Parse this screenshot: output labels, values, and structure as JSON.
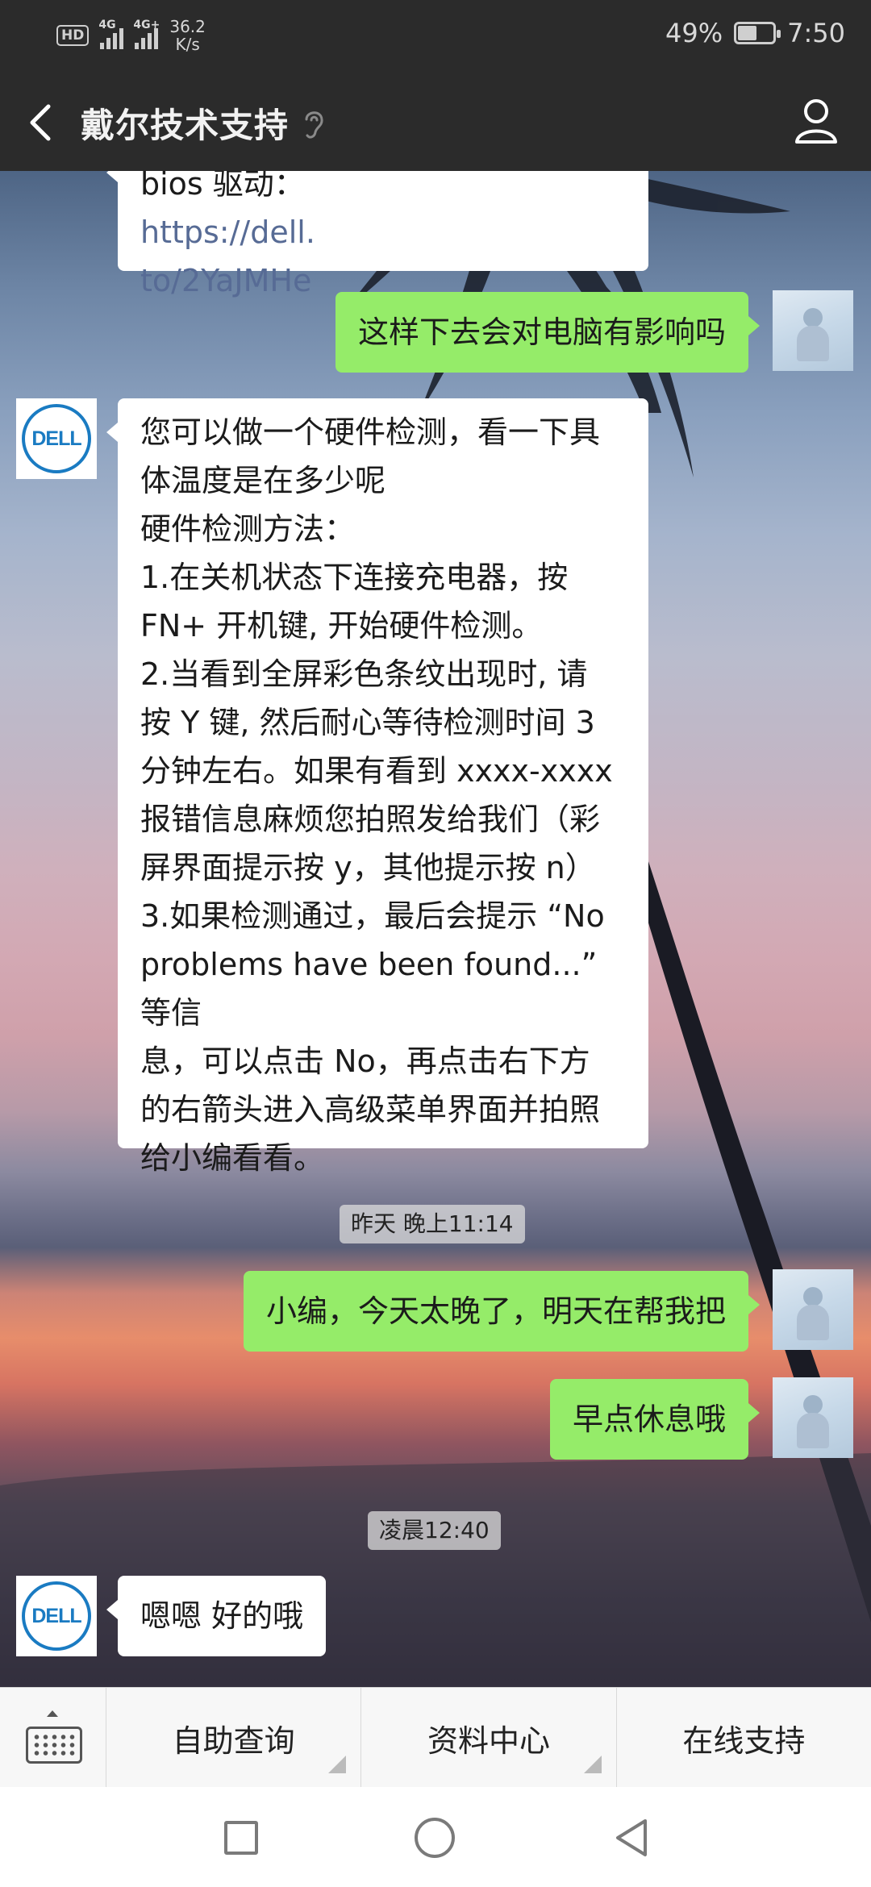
{
  "status_bar": {
    "hd": "HD",
    "signal1": "4G",
    "signal2": "4G+",
    "speed_value": "36.2",
    "speed_unit": "K/s",
    "battery": "49%",
    "battery_level": 0.49,
    "time": "7:50"
  },
  "header": {
    "title": "戴尔技术支持",
    "icons": [
      "back-arrow-icon",
      "ear-icon",
      "profile-icon"
    ]
  },
  "messages": {
    "m0": {
      "sender": "dell",
      "prefix": "bios 驱动：",
      "link1": "https://dell.",
      "link2": "to/2YaJMHe"
    },
    "m1": {
      "sender": "user",
      "text": "这样下去会对电脑有影响吗"
    },
    "m2": {
      "sender": "dell",
      "lines": [
        "您可以做一个硬件检测，看一下具",
        "体温度是在多少呢",
        "硬件检测方法：",
        "1.在关机状态下连接充电器，按",
        "FN+ 开机键, 开始硬件检测。",
        "2.当看到全屏彩色条纹出现时, 请",
        "按 Y 键, 然后耐心等待检测时间 3",
        "分钟左右。如果有看到 xxxx-xxxx",
        "报错信息麻烦您拍照发给我们（彩",
        "屏界面提示按 y，其他提示按 n）",
        "3.如果检测通过，最后会提示 “No",
        "problems have been found...” 等信",
        "息，可以点击 No，再点击右下方",
        "的右箭头进入高级菜单界面并拍照",
        "给小编看看。"
      ]
    },
    "ts1": "昨天 晚上11:14",
    "m3": {
      "sender": "user",
      "text": "小编，今天太晚了，明天在帮我把"
    },
    "m4": {
      "sender": "user",
      "text": "早点休息哦"
    },
    "ts2": "凌晨12:40",
    "m5": {
      "sender": "dell",
      "text": "嗯嗯 好的哦"
    }
  },
  "avatar_logo": "DELL",
  "menu": {
    "items": [
      "自助查询",
      "资料中心",
      "在线支持"
    ]
  },
  "colors": {
    "bar_bg": "#2b2b2b",
    "outgoing_bubble": "#95ec69",
    "incoming_bubble": "#ffffff",
    "link": "#576b95",
    "dell_blue": "#1a7bc2"
  }
}
